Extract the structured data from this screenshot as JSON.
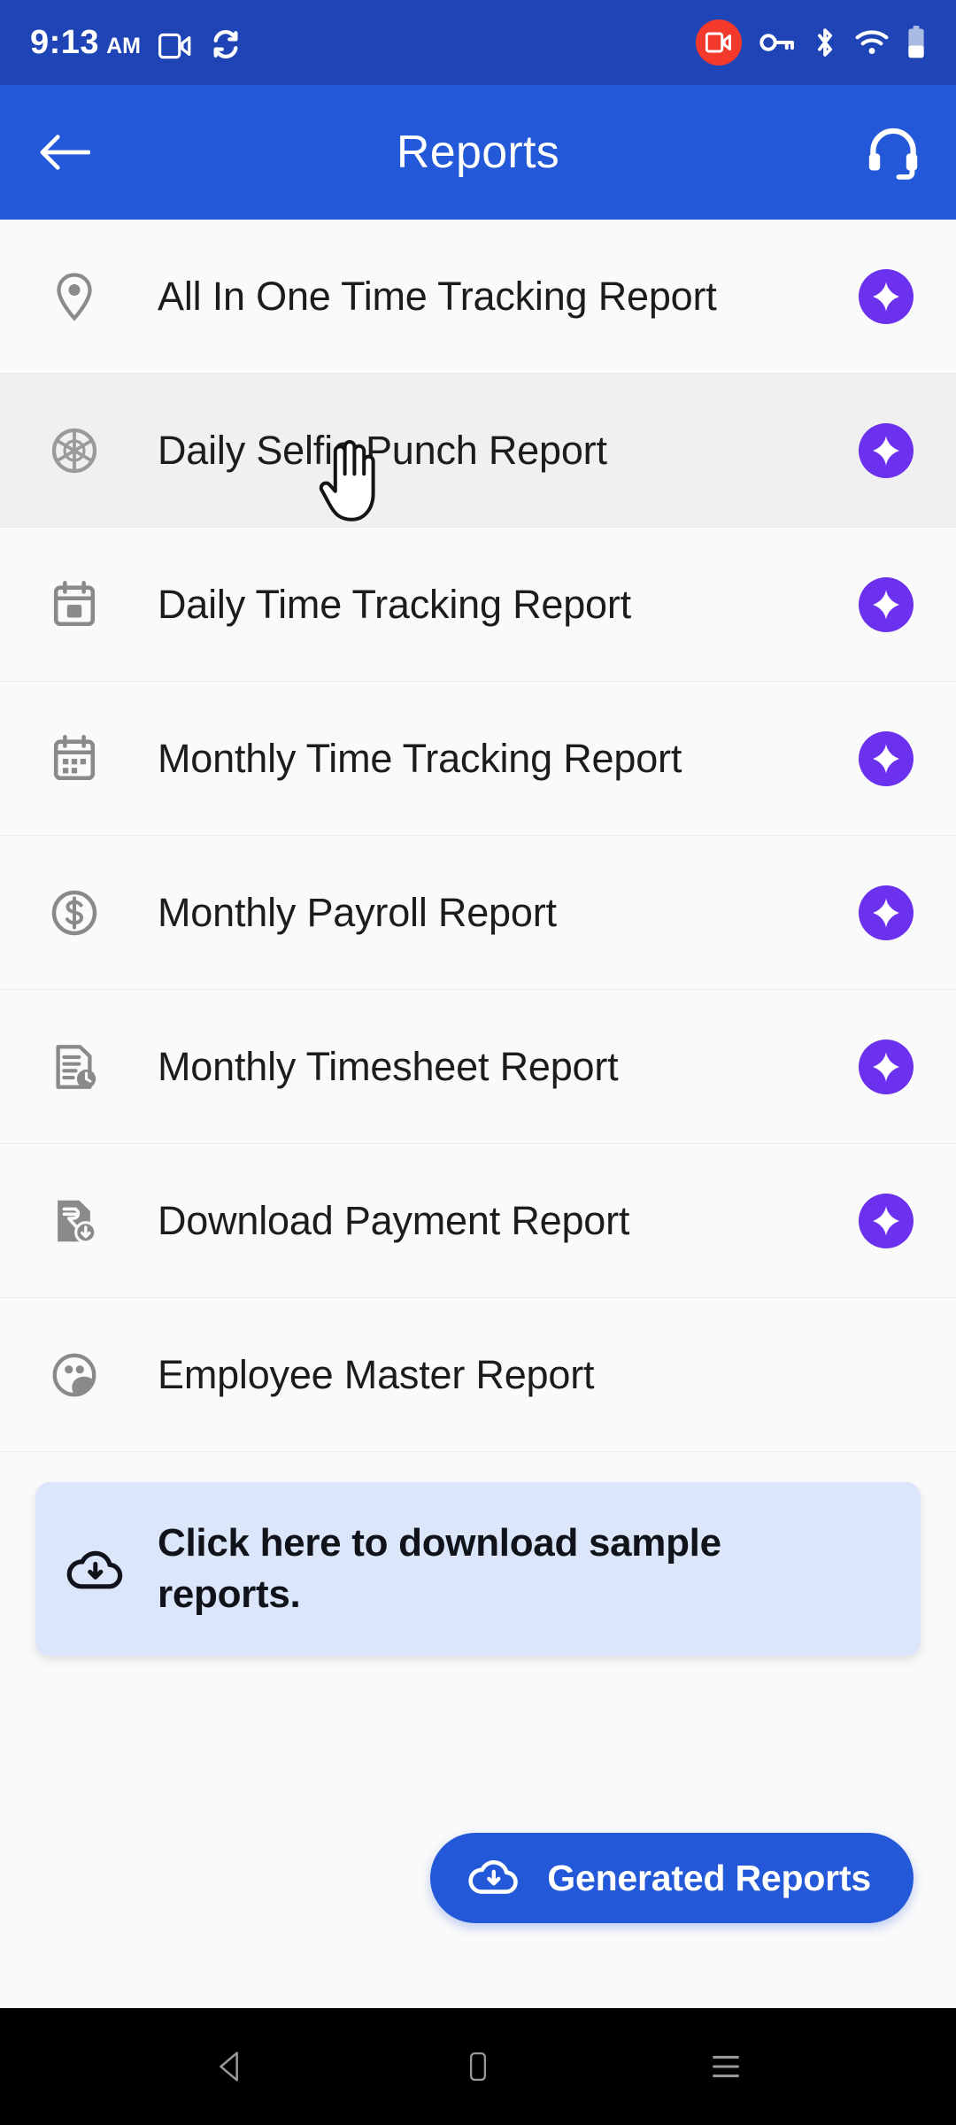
{
  "status_bar": {
    "time": "9:13",
    "ampm": "AM",
    "icons_left": [
      "video-camera-icon",
      "watch-sync-icon"
    ],
    "icons_right": [
      "screen-record-badge-icon",
      "key-icon",
      "bluetooth-icon",
      "wifi-icon",
      "battery-icon"
    ],
    "background": "#1F44B5"
  },
  "appbar": {
    "title": "Reports",
    "back_icon": "arrow-left-icon",
    "support_icon": "headset-icon",
    "background": "#2359D8"
  },
  "reports": {
    "items": [
      {
        "label": "All In One Time Tracking Report",
        "icon": "location-pin-icon",
        "premium": true,
        "pressed": false
      },
      {
        "label": "Daily Selfie Punch Report",
        "icon": "camera-aperture-icon",
        "premium": true,
        "pressed": true
      },
      {
        "label": "Daily Time Tracking Report",
        "icon": "calendar-day-icon",
        "premium": true,
        "pressed": false
      },
      {
        "label": "Monthly Time Tracking Report",
        "icon": "calendar-month-icon",
        "premium": true,
        "pressed": false
      },
      {
        "label": "Monthly Payroll Report",
        "icon": "dollar-circle-icon",
        "premium": true,
        "pressed": false
      },
      {
        "label": "Monthly Timesheet Report",
        "icon": "document-clock-icon",
        "premium": true,
        "pressed": false
      },
      {
        "label": "Download Payment Report",
        "icon": "rupee-document-download-icon",
        "premium": true,
        "pressed": false
      },
      {
        "label": "Employee Master Report",
        "icon": "people-group-icon",
        "premium": false,
        "pressed": false
      }
    ],
    "premium_badge_color": "#6B31EE",
    "premium_badge_icon": "sparkle-star-icon"
  },
  "banner": {
    "text": "Click here to download sample reports.",
    "icon": "cloud-download-icon",
    "background": "#DCE6FA"
  },
  "cta": {
    "label": "Generated Reports",
    "icon": "cloud-download-icon",
    "background": "#2359D8"
  },
  "navbar": {
    "back_icon": "nav-back-triangle-icon",
    "home_icon": "nav-home-icon",
    "recents_icon": "nav-recents-icon"
  },
  "cursor": {
    "icon": "hand-pointer-cursor"
  }
}
